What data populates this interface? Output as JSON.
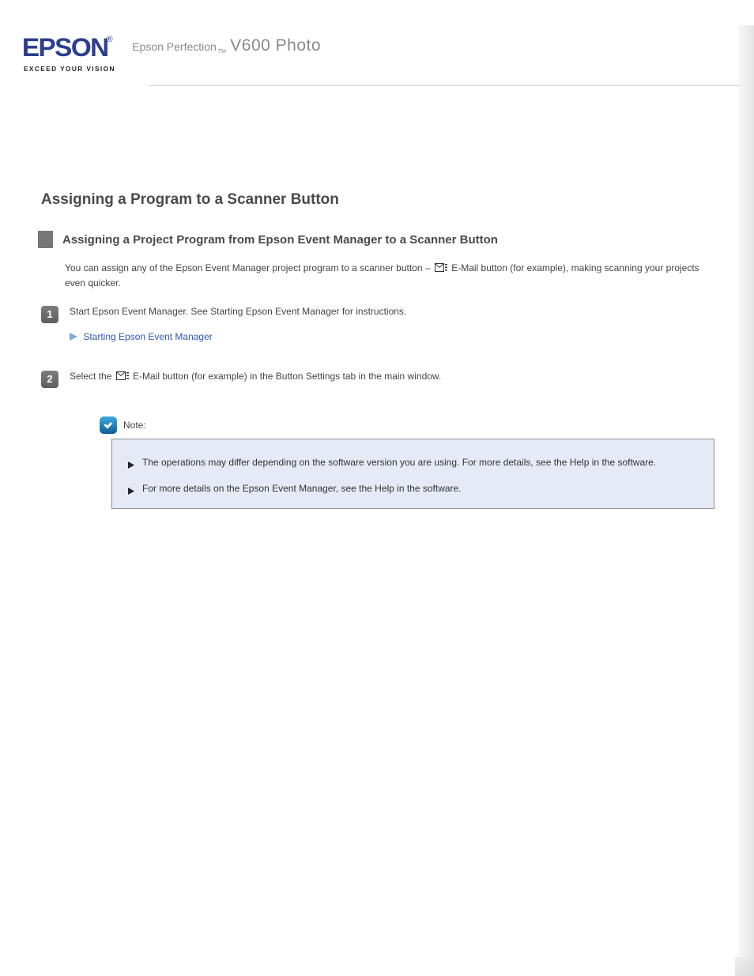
{
  "header": {
    "logo_text": "EPSON",
    "tagline": "EXCEED YOUR VISION",
    "product_prefix": "Epson Perfection",
    "product_tm": "TM",
    "product_model": "V600 Photo"
  },
  "page_title": "Assigning a Program to a Scanner Button",
  "section": {
    "heading": "Assigning a Project Program from Epson Event Manager to a Scanner Button",
    "intro_1": "You can assign any of the Epson Event Manager project program to a scanner button – ",
    "intro_2_after_icon": " E-Mail button (for example), making scanning your projects even quicker."
  },
  "steps": {
    "1": {
      "text_a": "Start Epson Event Manager. See ",
      "link": "Starting Epson Event Manager",
      "text_b": " for instructions."
    },
    "see_also_label": "Starting Epson Event Manager",
    "2": {
      "text_a": "Select the ",
      "icon_name": "mail-icon",
      "text_b": " E-Mail button (for example) in the Button Settings tab in the main window."
    }
  },
  "note": {
    "label": "Note:",
    "items": [
      "The operations may differ depending on the software version you are using. For more details, see the Help in the software.",
      "For more details on the Epson Event Manager, see the Help in the software."
    ]
  }
}
